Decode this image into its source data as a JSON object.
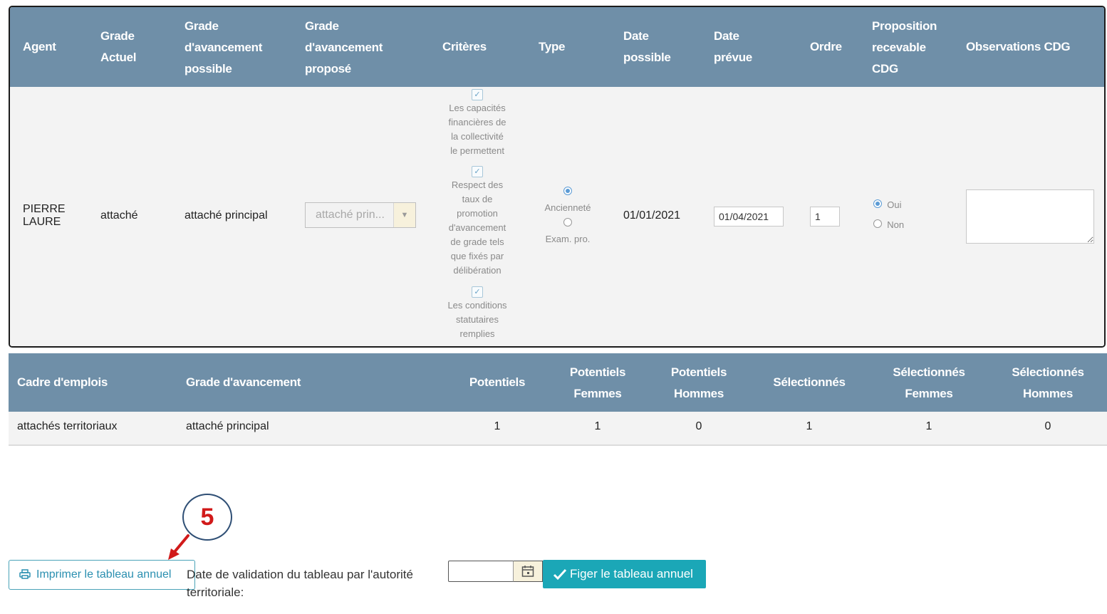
{
  "main_table": {
    "headers": {
      "agent": "Agent",
      "grade_actuel": [
        "Grade",
        "Actuel"
      ],
      "grade_possible": [
        "Grade",
        "d'avancement",
        "possible"
      ],
      "grade_propose": [
        "Grade",
        "d'avancement",
        "proposé"
      ],
      "criteres": "Critères",
      "type": "Type",
      "date_possible": [
        "Date",
        "possible"
      ],
      "date_prevue": [
        "Date",
        "prévue"
      ],
      "ordre": "Ordre",
      "proposition": [
        "Proposition",
        "recevable",
        "CDG"
      ],
      "observations": "Observations CDG"
    },
    "row": {
      "agent": [
        "PIERRE",
        "LAURE"
      ],
      "grade_actuel": "attaché",
      "grade_possible": "attaché principal",
      "grade_propose_select": "attaché prin...",
      "criteres": [
        {
          "checked": true,
          "text": [
            "Les capacités",
            "financières de",
            "la collectivité",
            "le permettent"
          ]
        },
        {
          "checked": true,
          "text": [
            "Respect des",
            "taux de",
            "promotion",
            "d'avancement",
            "de grade tels",
            "que fixés par",
            "délibération"
          ]
        },
        {
          "checked": true,
          "text": [
            "Les conditions",
            "statutaires",
            "remplies"
          ]
        }
      ],
      "type_options": [
        {
          "label": "Ancienneté",
          "selected": true
        },
        {
          "label": "Exam. pro.",
          "selected": false
        }
      ],
      "date_possible": "01/01/2021",
      "date_prevue": "01/04/2021",
      "ordre": "1",
      "proposition_options": [
        {
          "label": "Oui",
          "selected": true
        },
        {
          "label": "Non",
          "selected": false
        }
      ],
      "observations": ""
    }
  },
  "summary_table": {
    "headers": {
      "cadre": "Cadre d'emplois",
      "grade": "Grade d'avancement",
      "potentiels": "Potentiels",
      "potentiels_femmes": [
        "Potentiels",
        "Femmes"
      ],
      "potentiels_hommes": [
        "Potentiels",
        "Hommes"
      ],
      "selectionnes": "Sélectionnés",
      "selectionnes_femmes": [
        "Sélectionnés",
        "Femmes"
      ],
      "selectionnes_hommes": [
        "Sélectionnés",
        "Hommes"
      ]
    },
    "row": {
      "cadre": "attachés territoriaux",
      "grade": "attaché principal",
      "potentiels": "1",
      "potentiels_femmes": "1",
      "potentiels_hommes": "0",
      "selectionnes": "1",
      "selectionnes_femmes": "1",
      "selectionnes_hommes": "0"
    }
  },
  "footer": {
    "print_label": "Imprimer le tableau annuel",
    "validation_label": "Date de validation du tableau par l'autorité territoriale:",
    "validation_date": "",
    "freeze_label": "Figer le tableau annuel",
    "step_number": "5"
  },
  "colors": {
    "header_bg": "#6f8fa8",
    "teal_button": "#1ba7b7",
    "annotation_red": "#d11a1a",
    "annotation_navy": "#2f4f75"
  }
}
